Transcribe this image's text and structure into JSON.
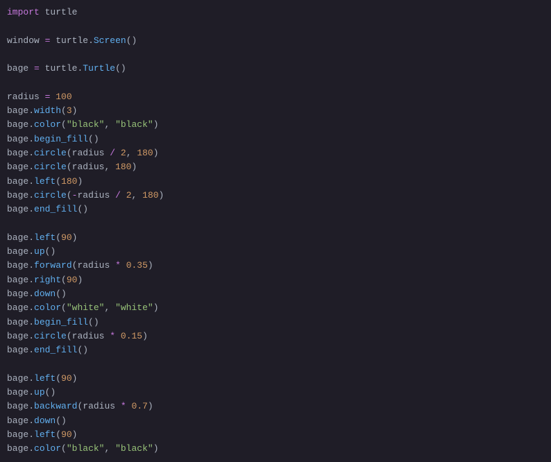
{
  "code": {
    "tokens": [
      [
        {
          "t": "import",
          "c": "kw"
        },
        {
          "t": " ",
          "c": "nm"
        },
        {
          "t": "turtle",
          "c": "nm"
        }
      ],
      [],
      [
        {
          "t": "window",
          "c": "nm"
        },
        {
          "t": " ",
          "c": "nm"
        },
        {
          "t": "=",
          "c": "op"
        },
        {
          "t": " ",
          "c": "nm"
        },
        {
          "t": "turtle",
          "c": "nm"
        },
        {
          "t": ".",
          "c": "pn"
        },
        {
          "t": "Screen",
          "c": "fn"
        },
        {
          "t": "()",
          "c": "pn"
        }
      ],
      [],
      [
        {
          "t": "bage",
          "c": "nm"
        },
        {
          "t": " ",
          "c": "nm"
        },
        {
          "t": "=",
          "c": "op"
        },
        {
          "t": " ",
          "c": "nm"
        },
        {
          "t": "turtle",
          "c": "nm"
        },
        {
          "t": ".",
          "c": "pn"
        },
        {
          "t": "Turtle",
          "c": "fn"
        },
        {
          "t": "()",
          "c": "pn"
        }
      ],
      [],
      [
        {
          "t": "radius",
          "c": "nm"
        },
        {
          "t": " ",
          "c": "nm"
        },
        {
          "t": "=",
          "c": "op"
        },
        {
          "t": " ",
          "c": "nm"
        },
        {
          "t": "100",
          "c": "nu"
        }
      ],
      [
        {
          "t": "bage",
          "c": "nm"
        },
        {
          "t": ".",
          "c": "pn"
        },
        {
          "t": "width",
          "c": "fn"
        },
        {
          "t": "(",
          "c": "pn"
        },
        {
          "t": "3",
          "c": "nu"
        },
        {
          "t": ")",
          "c": "pn"
        }
      ],
      [
        {
          "t": "bage",
          "c": "nm"
        },
        {
          "t": ".",
          "c": "pn"
        },
        {
          "t": "color",
          "c": "fn"
        },
        {
          "t": "(",
          "c": "pn"
        },
        {
          "t": "\"black\"",
          "c": "st"
        },
        {
          "t": ", ",
          "c": "pn"
        },
        {
          "t": "\"black\"",
          "c": "st"
        },
        {
          "t": ")",
          "c": "pn"
        }
      ],
      [
        {
          "t": "bage",
          "c": "nm"
        },
        {
          "t": ".",
          "c": "pn"
        },
        {
          "t": "begin_fill",
          "c": "fn"
        },
        {
          "t": "()",
          "c": "pn"
        }
      ],
      [
        {
          "t": "bage",
          "c": "nm"
        },
        {
          "t": ".",
          "c": "pn"
        },
        {
          "t": "circle",
          "c": "fn"
        },
        {
          "t": "(",
          "c": "pn"
        },
        {
          "t": "radius",
          "c": "nm"
        },
        {
          "t": " ",
          "c": "nm"
        },
        {
          "t": "/",
          "c": "op"
        },
        {
          "t": " ",
          "c": "nm"
        },
        {
          "t": "2",
          "c": "nu"
        },
        {
          "t": ", ",
          "c": "pn"
        },
        {
          "t": "180",
          "c": "nu"
        },
        {
          "t": ")",
          "c": "pn"
        }
      ],
      [
        {
          "t": "bage",
          "c": "nm"
        },
        {
          "t": ".",
          "c": "pn"
        },
        {
          "t": "circle",
          "c": "fn"
        },
        {
          "t": "(",
          "c": "pn"
        },
        {
          "t": "radius",
          "c": "nm"
        },
        {
          "t": ", ",
          "c": "pn"
        },
        {
          "t": "180",
          "c": "nu"
        },
        {
          "t": ")",
          "c": "pn"
        }
      ],
      [
        {
          "t": "bage",
          "c": "nm"
        },
        {
          "t": ".",
          "c": "pn"
        },
        {
          "t": "left",
          "c": "fn"
        },
        {
          "t": "(",
          "c": "pn"
        },
        {
          "t": "180",
          "c": "nu"
        },
        {
          "t": ")",
          "c": "pn"
        }
      ],
      [
        {
          "t": "bage",
          "c": "nm"
        },
        {
          "t": ".",
          "c": "pn"
        },
        {
          "t": "circle",
          "c": "fn"
        },
        {
          "t": "(",
          "c": "pn"
        },
        {
          "t": "-",
          "c": "op"
        },
        {
          "t": "radius",
          "c": "nm"
        },
        {
          "t": " ",
          "c": "nm"
        },
        {
          "t": "/",
          "c": "op"
        },
        {
          "t": " ",
          "c": "nm"
        },
        {
          "t": "2",
          "c": "nu"
        },
        {
          "t": ", ",
          "c": "pn"
        },
        {
          "t": "180",
          "c": "nu"
        },
        {
          "t": ")",
          "c": "pn"
        }
      ],
      [
        {
          "t": "bage",
          "c": "nm"
        },
        {
          "t": ".",
          "c": "pn"
        },
        {
          "t": "end_fill",
          "c": "fn"
        },
        {
          "t": "()",
          "c": "pn"
        }
      ],
      [],
      [
        {
          "t": "bage",
          "c": "nm"
        },
        {
          "t": ".",
          "c": "pn"
        },
        {
          "t": "left",
          "c": "fn"
        },
        {
          "t": "(",
          "c": "pn"
        },
        {
          "t": "90",
          "c": "nu"
        },
        {
          "t": ")",
          "c": "pn"
        }
      ],
      [
        {
          "t": "bage",
          "c": "nm"
        },
        {
          "t": ".",
          "c": "pn"
        },
        {
          "t": "up",
          "c": "fn"
        },
        {
          "t": "()",
          "c": "pn"
        }
      ],
      [
        {
          "t": "bage",
          "c": "nm"
        },
        {
          "t": ".",
          "c": "pn"
        },
        {
          "t": "forward",
          "c": "fn"
        },
        {
          "t": "(",
          "c": "pn"
        },
        {
          "t": "radius",
          "c": "nm"
        },
        {
          "t": " ",
          "c": "nm"
        },
        {
          "t": "*",
          "c": "op"
        },
        {
          "t": " ",
          "c": "nm"
        },
        {
          "t": "0.35",
          "c": "nu"
        },
        {
          "t": ")",
          "c": "pn"
        }
      ],
      [
        {
          "t": "bage",
          "c": "nm"
        },
        {
          "t": ".",
          "c": "pn"
        },
        {
          "t": "right",
          "c": "fn"
        },
        {
          "t": "(",
          "c": "pn"
        },
        {
          "t": "90",
          "c": "nu"
        },
        {
          "t": ")",
          "c": "pn"
        }
      ],
      [
        {
          "t": "bage",
          "c": "nm"
        },
        {
          "t": ".",
          "c": "pn"
        },
        {
          "t": "down",
          "c": "fn"
        },
        {
          "t": "()",
          "c": "pn"
        }
      ],
      [
        {
          "t": "bage",
          "c": "nm"
        },
        {
          "t": ".",
          "c": "pn"
        },
        {
          "t": "color",
          "c": "fn"
        },
        {
          "t": "(",
          "c": "pn"
        },
        {
          "t": "\"white\"",
          "c": "st"
        },
        {
          "t": ", ",
          "c": "pn"
        },
        {
          "t": "\"white\"",
          "c": "st"
        },
        {
          "t": ")",
          "c": "pn"
        }
      ],
      [
        {
          "t": "bage",
          "c": "nm"
        },
        {
          "t": ".",
          "c": "pn"
        },
        {
          "t": "begin_fill",
          "c": "fn"
        },
        {
          "t": "()",
          "c": "pn"
        }
      ],
      [
        {
          "t": "bage",
          "c": "nm"
        },
        {
          "t": ".",
          "c": "pn"
        },
        {
          "t": "circle",
          "c": "fn"
        },
        {
          "t": "(",
          "c": "pn"
        },
        {
          "t": "radius",
          "c": "nm"
        },
        {
          "t": " ",
          "c": "nm"
        },
        {
          "t": "*",
          "c": "op"
        },
        {
          "t": " ",
          "c": "nm"
        },
        {
          "t": "0.15",
          "c": "nu"
        },
        {
          "t": ")",
          "c": "pn"
        }
      ],
      [
        {
          "t": "bage",
          "c": "nm"
        },
        {
          "t": ".",
          "c": "pn"
        },
        {
          "t": "end_fill",
          "c": "fn"
        },
        {
          "t": "()",
          "c": "pn"
        }
      ],
      [],
      [
        {
          "t": "bage",
          "c": "nm"
        },
        {
          "t": ".",
          "c": "pn"
        },
        {
          "t": "left",
          "c": "fn"
        },
        {
          "t": "(",
          "c": "pn"
        },
        {
          "t": "90",
          "c": "nu"
        },
        {
          "t": ")",
          "c": "pn"
        }
      ],
      [
        {
          "t": "bage",
          "c": "nm"
        },
        {
          "t": ".",
          "c": "pn"
        },
        {
          "t": "up",
          "c": "fn"
        },
        {
          "t": "()",
          "c": "pn"
        }
      ],
      [
        {
          "t": "bage",
          "c": "nm"
        },
        {
          "t": ".",
          "c": "pn"
        },
        {
          "t": "backward",
          "c": "fn"
        },
        {
          "t": "(",
          "c": "pn"
        },
        {
          "t": "radius",
          "c": "nm"
        },
        {
          "t": " ",
          "c": "nm"
        },
        {
          "t": "*",
          "c": "op"
        },
        {
          "t": " ",
          "c": "nm"
        },
        {
          "t": "0.7",
          "c": "nu"
        },
        {
          "t": ")",
          "c": "pn"
        }
      ],
      [
        {
          "t": "bage",
          "c": "nm"
        },
        {
          "t": ".",
          "c": "pn"
        },
        {
          "t": "down",
          "c": "fn"
        },
        {
          "t": "()",
          "c": "pn"
        }
      ],
      [
        {
          "t": "bage",
          "c": "nm"
        },
        {
          "t": ".",
          "c": "pn"
        },
        {
          "t": "left",
          "c": "fn"
        },
        {
          "t": "(",
          "c": "pn"
        },
        {
          "t": "90",
          "c": "nu"
        },
        {
          "t": ")",
          "c": "pn"
        }
      ],
      [
        {
          "t": "bage",
          "c": "nm"
        },
        {
          "t": ".",
          "c": "pn"
        },
        {
          "t": "color",
          "c": "fn"
        },
        {
          "t": "(",
          "c": "pn"
        },
        {
          "t": "\"black\"",
          "c": "st"
        },
        {
          "t": ", ",
          "c": "pn"
        },
        {
          "t": "\"black\"",
          "c": "st"
        },
        {
          "t": ")",
          "c": "pn"
        }
      ]
    ]
  }
}
